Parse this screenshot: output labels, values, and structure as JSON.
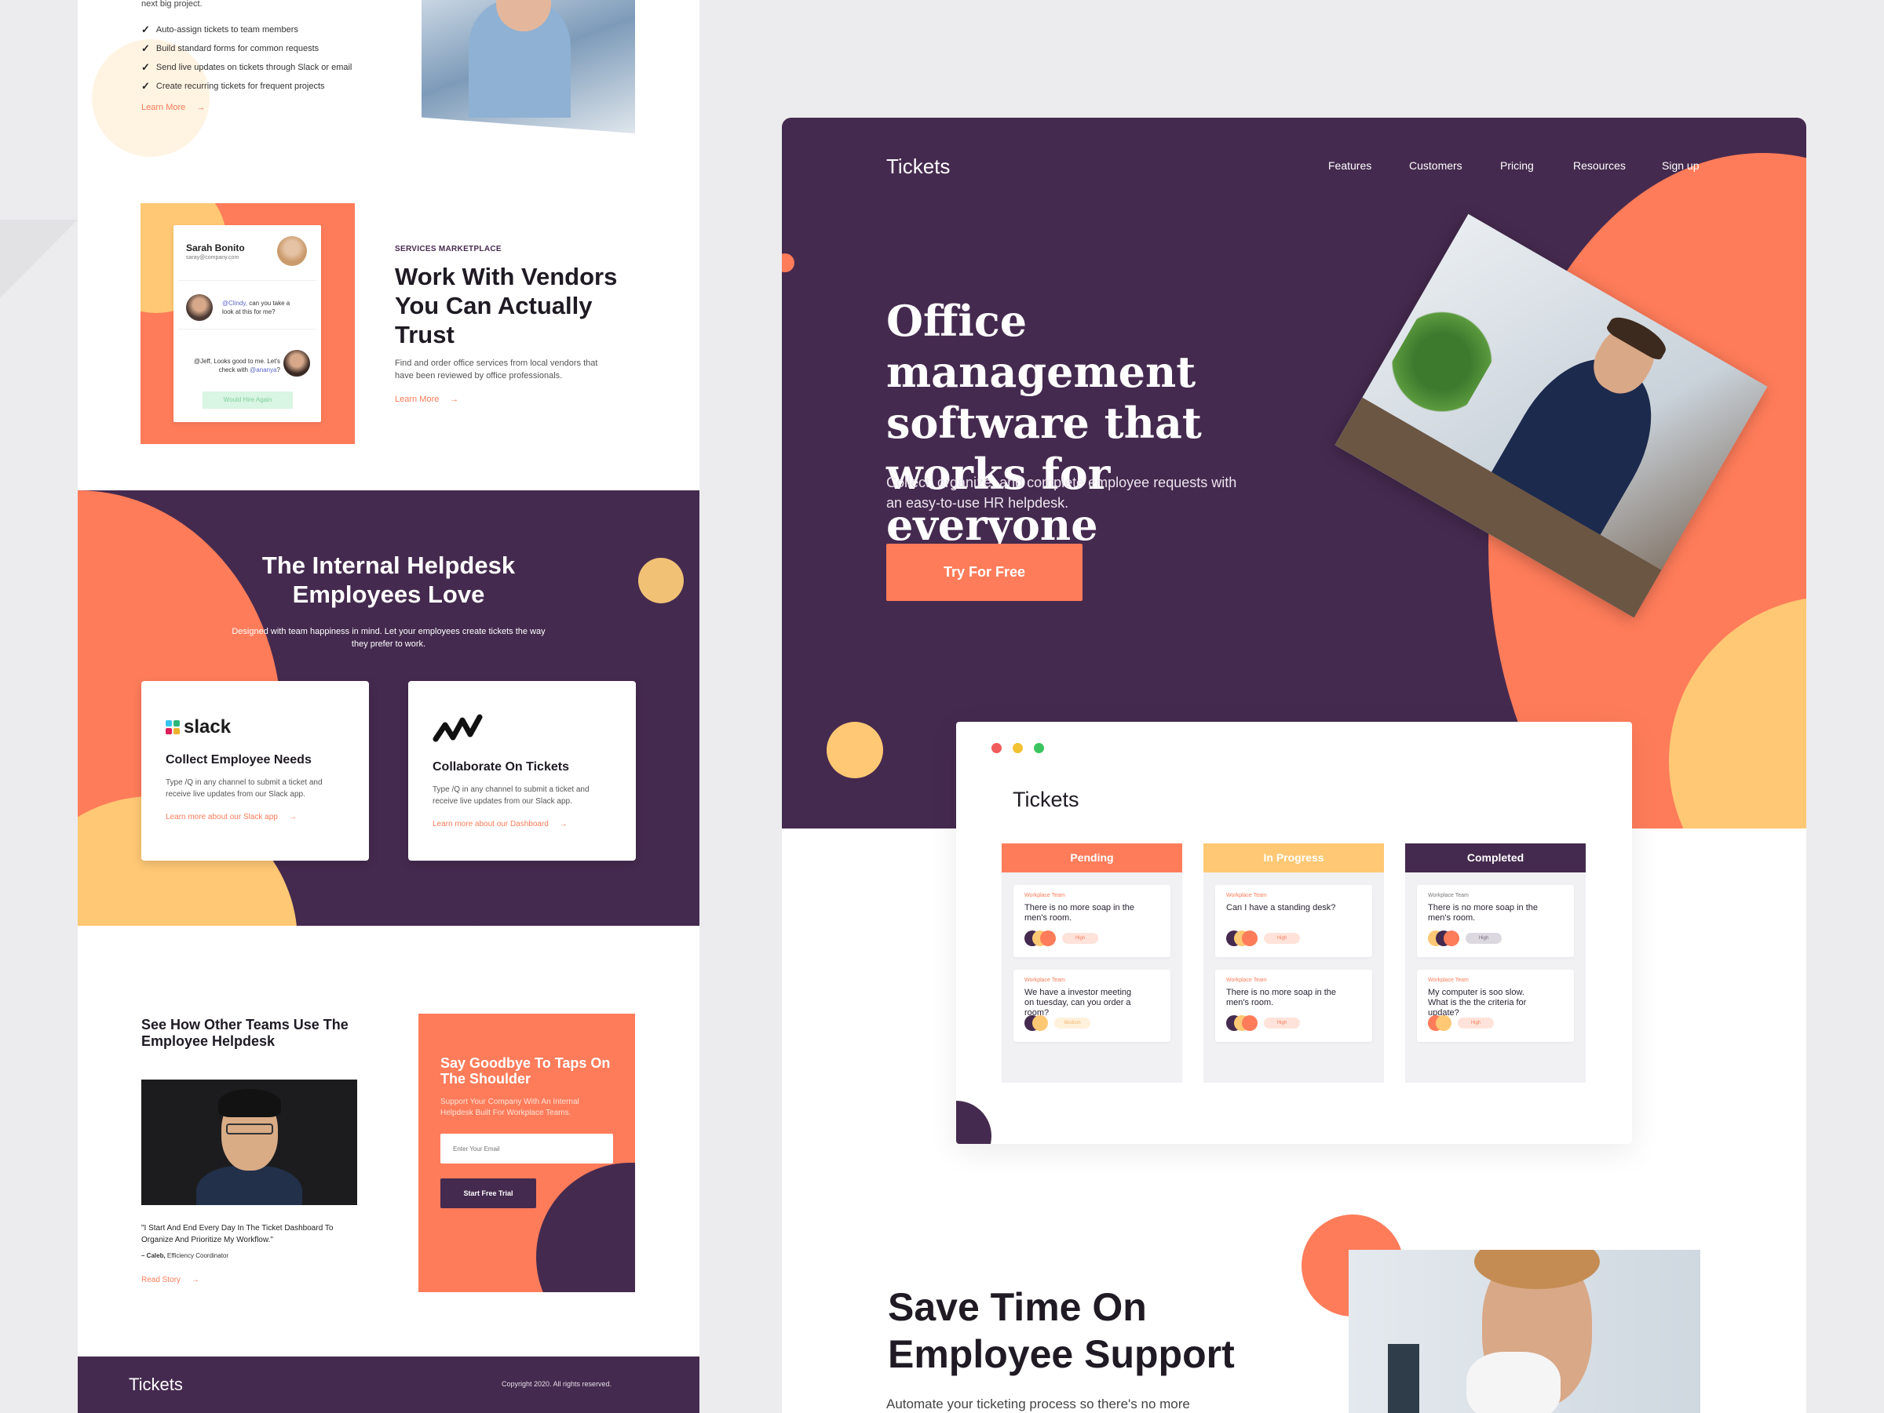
{
  "left": {
    "top": {
      "intro_tail": "next big project.",
      "checks": [
        "Auto-assign tickets to team members",
        "Build standard forms for common requests",
        "Send live updates on tickets through Slack or email",
        "Create recurring tickets for frequent projects"
      ],
      "learn_more": "Learn More"
    },
    "vendors": {
      "profile_name": "Sarah Bonito",
      "profile_email": "saray@company.com",
      "msg1_mention": "@Clindy,",
      "msg1_text": " can you take a look at this for me?",
      "msg2_text": "@Jeff, Looks good to me. Let's check with ",
      "msg2_mention": "@ananya",
      "msg2_end": "?",
      "badge": "Would Hire Again",
      "eyebrow": "SERVICES MARKETPLACE",
      "title": "Work With Vendors You Can Actually Trust",
      "desc": "Find and order office services from local vendors that have been reviewed by office professionals.",
      "learn_more": "Learn More"
    },
    "helpdesk": {
      "title": "The Internal Helpdesk Employees Love",
      "desc": "Designed with team happiness in mind. Let your employees create tickets the way they prefer to work.",
      "card1": {
        "logo": "slack",
        "title": "Collect Employee Needs",
        "desc": "Type /Q in any channel to submit a ticket and receive live updates from our Slack app.",
        "link": "Learn more about our Slack app"
      },
      "card2": {
        "title": "Collaborate On Tickets",
        "desc": "Type /Q in any channel to submit a ticket and receive live updates from our Slack app.",
        "link": "Learn more about our Dashboard"
      }
    },
    "teams": {
      "title": "See How Other Teams Use The Employee Helpdesk",
      "quote": "\"I Start And End Every Day In The Ticket Dashboard To Organize And Prioritize My Workflow.\"",
      "author_name": "– Caleb,",
      "author_role": " Efficiency Coordinator",
      "read_story": "Read Story"
    },
    "cta": {
      "title": "Say Goodbye To Taps On The Shoulder",
      "desc": "Support Your Company With An Internal Helpdesk Built For Workplace Teams.",
      "email_placeholder": "Enter Your Email",
      "button": "Start Free Trial"
    },
    "footer": {
      "logo": "Tickets",
      "copyright": "Copyright 2020. All rights reserved."
    }
  },
  "right": {
    "nav": {
      "logo": "Tickets",
      "links": [
        "Features",
        "Customers",
        "Pricing",
        "Resources",
        "Sign up"
      ]
    },
    "hero": {
      "title": "Office management software that works for everyone",
      "desc": "Collect, organize, and complete employee requests with an easy-to-use HR helpdesk.",
      "cta": "Try For Free"
    },
    "board": {
      "title": "Tickets",
      "columns": [
        {
          "label": "Pending",
          "tickets": [
            {
              "team": "Workplace Team",
              "text": "There is no more soap in the men's room.",
              "tag": "High"
            },
            {
              "team": "Workplace Team",
              "text": "We have a investor meeting on tuesday, can you order a room?",
              "tag": "Medium"
            }
          ]
        },
        {
          "label": "In Progress",
          "tickets": [
            {
              "team": "Workplace Team",
              "text": "Can I have a standing desk?",
              "tag": "High"
            },
            {
              "team": "Workplace Team",
              "text": "There is no more soap in the men's room.",
              "tag": "High"
            }
          ]
        },
        {
          "label": "Completed",
          "tickets": [
            {
              "team": "Workplace Team",
              "text": "There is no more soap in the men's room.",
              "tag": "High"
            },
            {
              "team": "Workplace Team",
              "text": "My computer is soo slow. What is the the criteria for update?",
              "tag": "High"
            }
          ]
        }
      ]
    },
    "save": {
      "title": "Save Time On Employee Support",
      "desc": "Automate your ticketing process so there's no more"
    }
  },
  "colors": {
    "purple": "#452a4f",
    "coral": "#fe7c5a",
    "yellow": "#fec874",
    "page_bg": "#ececee"
  }
}
